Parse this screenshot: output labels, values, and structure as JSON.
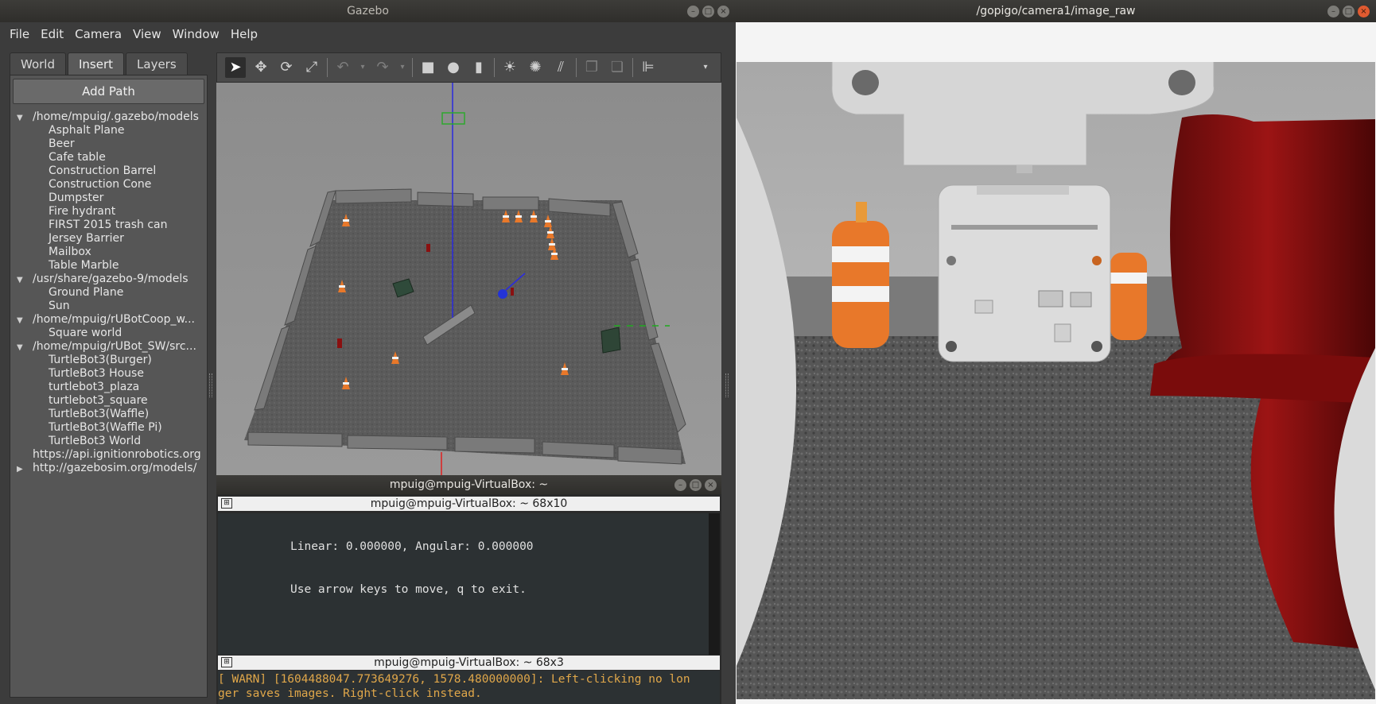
{
  "gazebo": {
    "title": "Gazebo",
    "menu": [
      "File",
      "Edit",
      "Camera",
      "View",
      "Window",
      "Help"
    ],
    "tabs": [
      "World",
      "Insert",
      "Layers"
    ],
    "selected_tab": "Insert",
    "add_path_label": "Add Path",
    "tree": [
      {
        "label": "/home/mpuig/.gazebo/models",
        "expanded": true,
        "children": [
          "Asphalt Plane",
          "Beer",
          "Cafe table",
          "Construction Barrel",
          "Construction Cone",
          "Dumpster",
          "Fire hydrant",
          "FIRST 2015 trash can",
          "Jersey Barrier",
          "Mailbox",
          "Table Marble"
        ]
      },
      {
        "label": "/usr/share/gazebo-9/models",
        "expanded": true,
        "children": [
          "Ground Plane",
          "Sun"
        ]
      },
      {
        "label": "/home/mpuig/rUBotCoop_w...",
        "expanded": true,
        "children": [
          "Square world"
        ]
      },
      {
        "label": "/home/mpuig/rUBot_SW/src...",
        "expanded": true,
        "children": [
          "TurtleBot3(Burger)",
          "TurtleBot3 House",
          "turtlebot3_plaza",
          "turtlebot3_square",
          "TurtleBot3(Waffle)",
          "TurtleBot3(Waffle Pi)",
          "TurtleBot3 World"
        ]
      },
      {
        "label": "https://api.ignitionrobotics.org",
        "expanded": null,
        "children": []
      },
      {
        "label": "http://gazebosim.org/models/",
        "expanded": false,
        "children": []
      }
    ],
    "toolbar_icons": [
      "select-arrow-icon",
      "translate-icon",
      "rotate-icon",
      "scale-icon",
      "undo-icon",
      "redo-icon",
      "box-icon",
      "sphere-icon",
      "cylinder-icon",
      "point-light-icon",
      "spot-light-icon",
      "directional-light-icon",
      "copy-icon",
      "paste-icon",
      "align-icon"
    ]
  },
  "terminal": {
    "window_title": "mpuig@mpuig-VirtualBox: ~",
    "pane1_title": "mpuig@mpuig-VirtualBox: ~ 68x10",
    "pane1_lines": [
      "Linear: 0.000000, Angular: 0.000000",
      "Use arrow keys to move, q to exit."
    ],
    "pane2_title": "mpuig@mpuig-VirtualBox: ~ 68x3",
    "pane2_lines": [
      "[ WARN] [1604488047.773649276, 1578.480000000]: Left-clicking no lon",
      "ger saves images. Right-click instead."
    ]
  },
  "camera": {
    "title": "/gopigo/camera1/image_raw"
  },
  "colors": {
    "window_bg": "#3c3c3c",
    "panel_bg": "#565656",
    "close_button": "#e05a30",
    "cone_orange": "#e8782a",
    "hydrant_red": "#8a1010",
    "warn_text": "#e0a74a"
  }
}
